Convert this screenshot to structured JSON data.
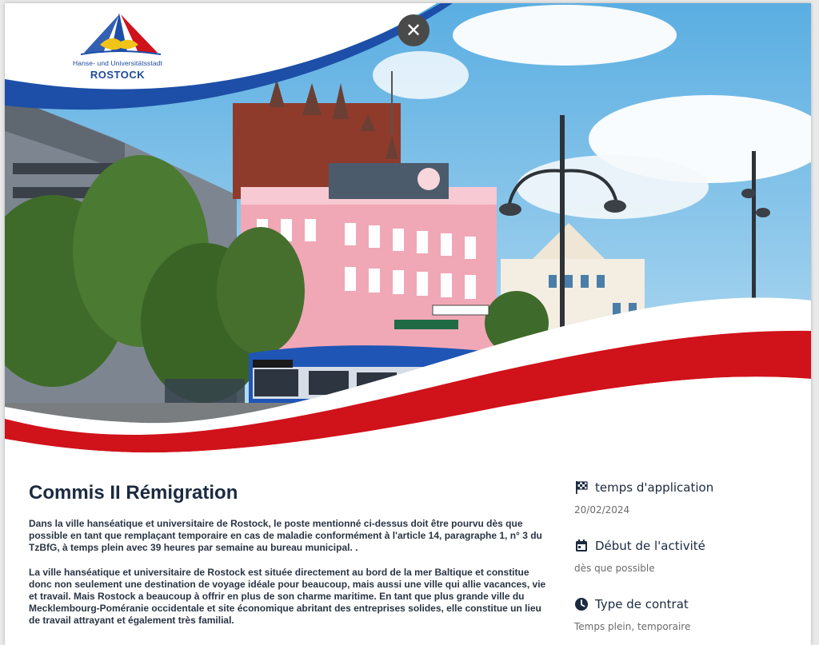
{
  "logo": {
    "line1": "Hanse- und Universitätsstadt",
    "line2": "ROSTOCK"
  },
  "close_icon": "close-icon",
  "job": {
    "title": "Commis II Rémigration",
    "paragraphs": [
      "Dans la ville hanséatique et universitaire de Rostock, le poste mentionné ci-dessus doit être pourvu dès que possible en tant que remplaçant temporaire en cas de maladie conformément à l'article 14, paragraphe 1, n° 3 du TzBfG, à temps plein avec 39 heures par semaine au bureau municipal. .",
      "La ville hanséatique et universitaire de Rostock est située directement au bord de la mer Baltique et constitue donc non seulement une destination de voyage idéale pour beaucoup, mais aussi une ville qui allie vacances, vie et travail. Mais Rostock a beaucoup à offrir en plus de son charme maritime. En tant que plus grande ville du Mecklembourg-Poméranie occidentale et site économique abritant des entreprises solides, elle constitue un lieu de travail attrayant et également très familial."
    ]
  },
  "sidebar": {
    "application": {
      "label": "temps d'application",
      "value": "20/02/2024",
      "icon": "flag-checkered-icon"
    },
    "start": {
      "label": "Début de l'activité",
      "value": "dès que possible",
      "icon": "calendar-icon"
    },
    "contract": {
      "label": "Type de contrat",
      "value": "Temps plein, temporaire",
      "icon": "clock-icon"
    }
  },
  "colors": {
    "brand_blue": "#1d4fa8",
    "brand_red": "#d0121b",
    "sky": "#6fb8e6"
  }
}
